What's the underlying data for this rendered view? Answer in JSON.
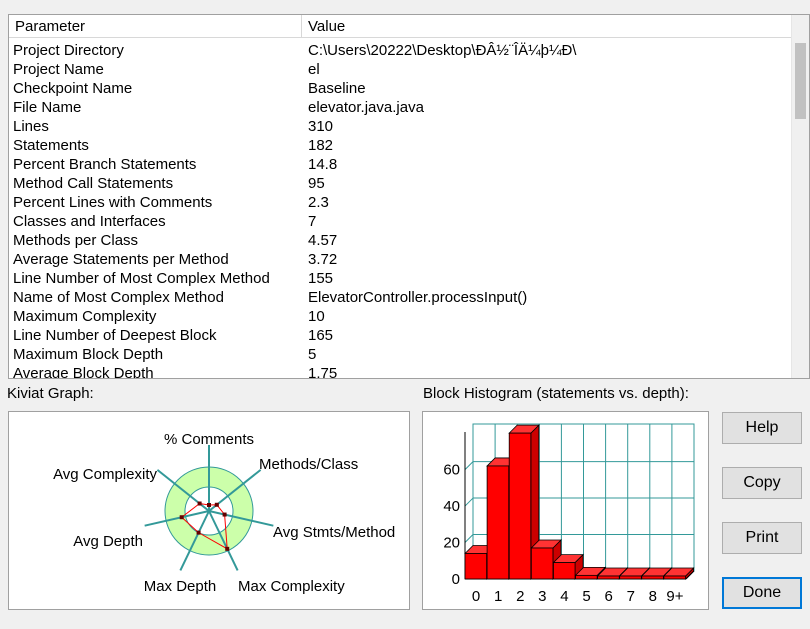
{
  "table": {
    "headers": {
      "parameter": "Parameter",
      "value": "Value"
    },
    "rows": [
      {
        "parameter": "Project Directory",
        "value": "C:\\Users\\20222\\Desktop\\ÐÂ½¨ÎÄ¼þ¼Ð\\"
      },
      {
        "parameter": "Project Name",
        "value": "el"
      },
      {
        "parameter": "Checkpoint Name",
        "value": "Baseline"
      },
      {
        "parameter": "File Name",
        "value": "elevator.java.java"
      },
      {
        "parameter": "Lines",
        "value": "310"
      },
      {
        "parameter": "Statements",
        "value": "182"
      },
      {
        "parameter": "Percent Branch Statements",
        "value": "14.8"
      },
      {
        "parameter": "Method Call Statements",
        "value": "95"
      },
      {
        "parameter": "Percent Lines with Comments",
        "value": "2.3"
      },
      {
        "parameter": "Classes and Interfaces",
        "value": "7"
      },
      {
        "parameter": "Methods per Class",
        "value": "4.57"
      },
      {
        "parameter": "Average Statements per Method",
        "value": "3.72"
      },
      {
        "parameter": "Line Number of Most Complex Method",
        "value": "155"
      },
      {
        "parameter": "Name of Most Complex Method",
        "value": "ElevatorController.processInput()"
      },
      {
        "parameter": "Maximum Complexity",
        "value": "10"
      },
      {
        "parameter": "Line Number of Deepest Block",
        "value": "165"
      },
      {
        "parameter": "Maximum Block Depth",
        "value": "5"
      },
      {
        "parameter": "Average Block Depth",
        "value": "1.75"
      }
    ]
  },
  "kiviat": {
    "label": "Kiviat Graph:",
    "axes": [
      "% Comments",
      "Methods/Class",
      "Avg Stmts/Method",
      "Max Complexity",
      "Max Depth",
      "Avg Depth",
      "Avg Complexity"
    ],
    "colors": {
      "band": "#ccffaa",
      "inner": "#ffffff",
      "spokes": "#339999",
      "polygon": "#ff0000",
      "points": "#660000"
    }
  },
  "histogram": {
    "label": "Block Histogram (statements vs. depth):",
    "y_ticks": [
      "0",
      "20",
      "40",
      "60"
    ],
    "x_ticks": [
      "0",
      "1",
      "2",
      "3",
      "4",
      "5",
      "6",
      "7",
      "8",
      "9+"
    ],
    "colors": {
      "bar": "#ff0000",
      "grid": "#339999"
    }
  },
  "buttons": {
    "help": "Help",
    "copy": "Copy",
    "print": "Print",
    "done": "Done"
  },
  "chart_data": {
    "type": "bar",
    "categories": [
      "0",
      "1",
      "2",
      "3",
      "4",
      "5",
      "6",
      "7",
      "8",
      "9+"
    ],
    "values": [
      14,
      62,
      80,
      17,
      9,
      2,
      0,
      0,
      0,
      0
    ],
    "title": "",
    "xlabel": "",
    "ylabel": "",
    "ylim": [
      0,
      85
    ],
    "grid": true
  }
}
